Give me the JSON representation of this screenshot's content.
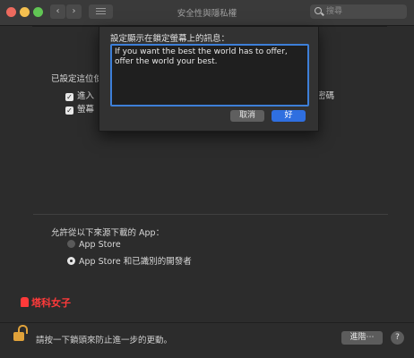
{
  "window": {
    "title": "安全性與隱私權",
    "search_placeholder": "搜尋",
    "nav_back": "‹",
    "nav_forward": "›"
  },
  "general": {
    "section_label": "已設定這位使",
    "options": [
      {
        "label": "進入",
        "checked": true
      },
      {
        "label": "螢幕",
        "checked": true
      }
    ],
    "right_suffix": "密碼"
  },
  "download_sources": {
    "label": "允許從以下來源下載的 App：",
    "options": [
      {
        "label": "App Store",
        "selected": false
      },
      {
        "label": "App Store 和已識別的開發者",
        "selected": true
      }
    ]
  },
  "watermark": "塔科女子",
  "footer": {
    "lock_text": "請按一下鎖頭來防止進一步的更動。",
    "advanced_button": "進階⋯",
    "help_button": "?"
  },
  "sheet": {
    "title": "設定顯示在鎖定螢幕上的訊息：",
    "message": "If you want the best the world has to offer, offer the world your best.",
    "cancel_label": "取消",
    "ok_label": "好"
  },
  "colors": {
    "accent": "#2f6fe0",
    "focus_ring": "#3d7fd8",
    "watermark": "#ff3a3a",
    "lock": "#e0a23a"
  }
}
